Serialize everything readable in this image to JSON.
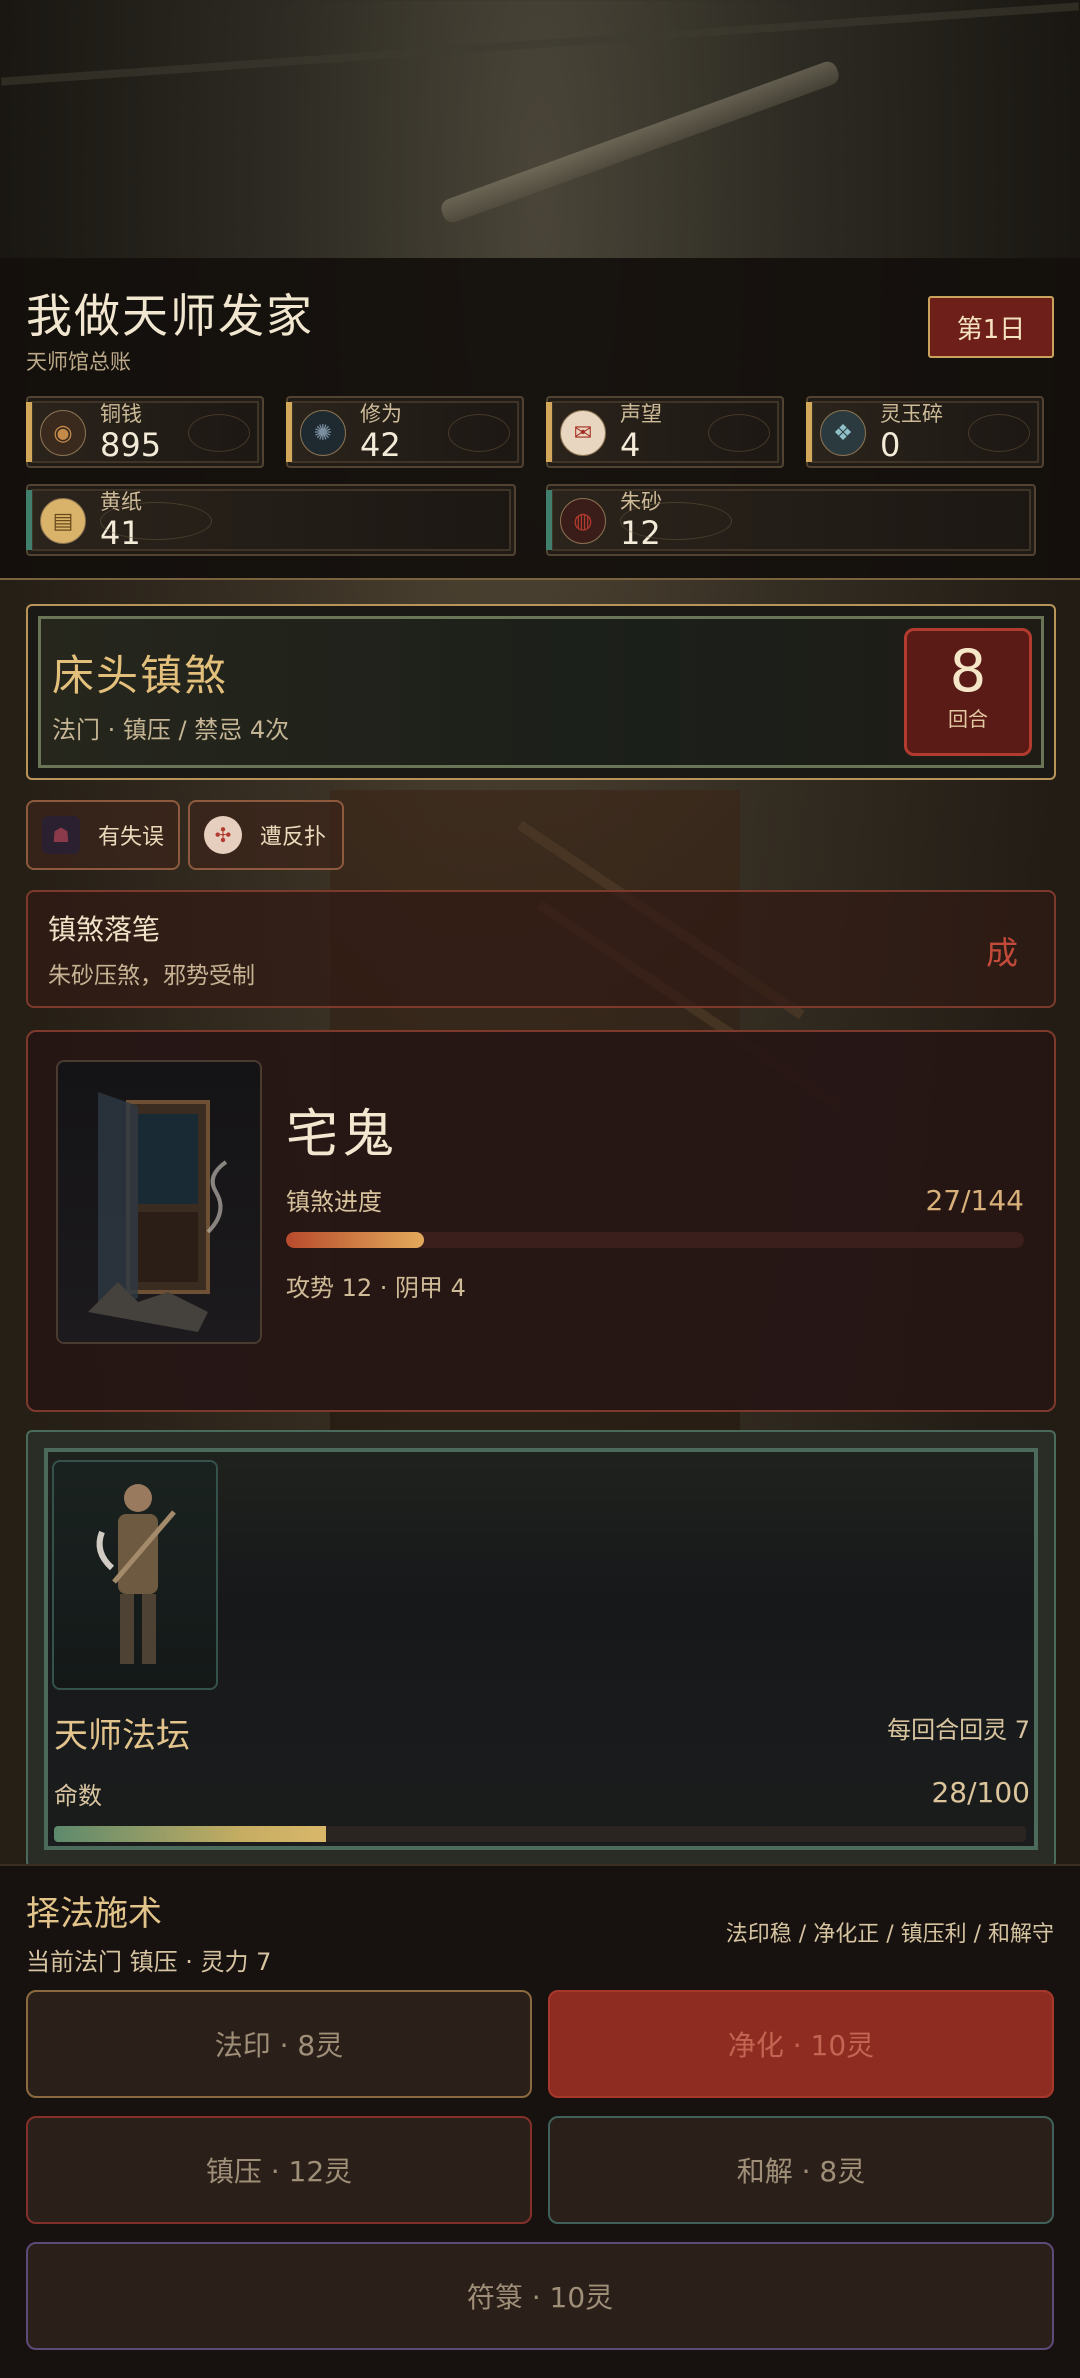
{
  "header": {
    "title": "我做天师发家",
    "subtitle": "天师馆总账",
    "day": "第1日",
    "resources": [
      {
        "label": "铜钱",
        "value": "895",
        "icon": "coin-icon"
      },
      {
        "label": "修为",
        "value": "42",
        "icon": "cultivation-icon"
      },
      {
        "label": "声望",
        "value": "4",
        "icon": "reputation-icon"
      },
      {
        "label": "灵玉碎",
        "value": "0",
        "icon": "jade-shard-icon"
      },
      {
        "label": "黄纸",
        "value": "41",
        "icon": "yellow-paper-icon"
      },
      {
        "label": "朱砂",
        "value": "12",
        "icon": "cinnabar-icon"
      }
    ]
  },
  "spell": {
    "name": "床头镇煞",
    "meta": "法门 · 镇压  /  禁忌 4次",
    "rounds": "8",
    "rounds_label": "回合"
  },
  "tags": [
    {
      "label": "有失误",
      "icon": "mistake-icon"
    },
    {
      "label": "遭反扑",
      "icon": "backlash-icon"
    }
  ],
  "event": {
    "title": "镇煞落笔",
    "desc": "朱砂压煞，邪势受制",
    "result": "成"
  },
  "enemy": {
    "name": "宅鬼",
    "progress_label": "镇煞进度",
    "progress_text": "27/144",
    "progress_value": 27,
    "progress_max": 144,
    "stats": "攻势 12  ·  阴甲 4"
  },
  "altar": {
    "name": "天师法坛",
    "regen": "每回合回灵 7",
    "life_label": "命数",
    "life_text": "28/100",
    "life_value": 28,
    "life_max": 100
  },
  "actions": {
    "title": "择法施术",
    "sub": "当前法门 镇压 · 灵力 7",
    "hint": "法印稳 / 净化正 / 镇压利 / 和解守",
    "skills": [
      {
        "label": "法印 · 8灵"
      },
      {
        "label": "净化 · 10灵"
      },
      {
        "label": "镇压 · 12灵"
      },
      {
        "label": "和解 · 8灵"
      },
      {
        "label": "符箓 · 10灵"
      }
    ]
  },
  "colors": {
    "accent_gold": "#d3a85a",
    "danger_red": "#8e2c22",
    "panel_dark": "#17120f"
  }
}
